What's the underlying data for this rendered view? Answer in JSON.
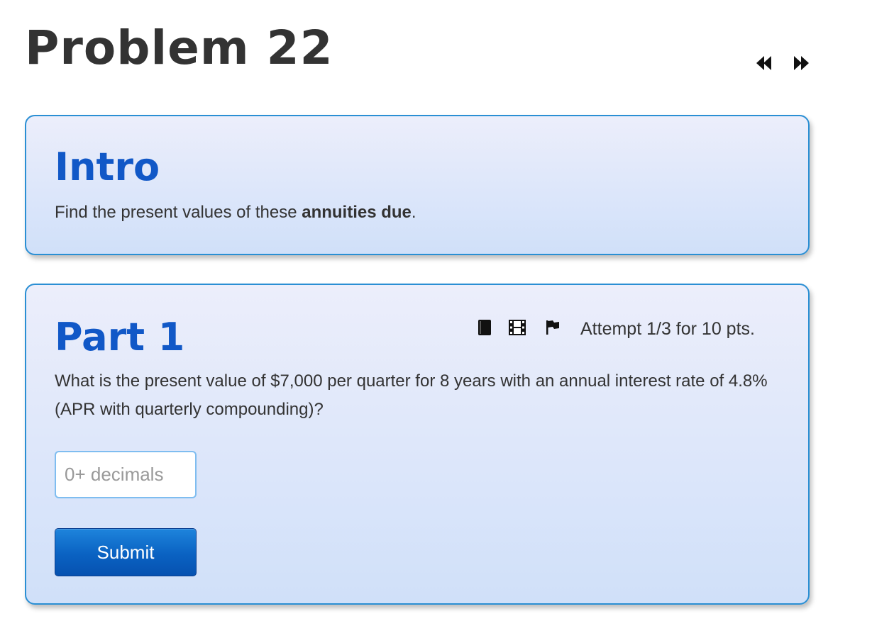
{
  "page": {
    "title": "Problem 22"
  },
  "nav": {
    "prev_icon": "rewind-icon",
    "next_icon": "fast-forward-icon"
  },
  "intro": {
    "heading": "Intro",
    "text_before": "Find the present values of these ",
    "text_bold": "annuities due",
    "text_after": "."
  },
  "part1": {
    "heading": "Part 1",
    "toolbar_icons": [
      "book-icon",
      "film-icon",
      "flag-icon"
    ],
    "attempt": "Attempt 1/3 for 10 pts.",
    "question": "What is the present value of $7,000 per quarter for 8 years with an annual interest rate of 4.8% (APR with quarterly compounding)?",
    "input": {
      "value": "",
      "placeholder": "0+ decimals"
    },
    "submit_label": "Submit"
  },
  "colors": {
    "heading_blue": "#1158c7",
    "card_border": "#2a8fd4",
    "button_blue": "#0a62c2",
    "text": "#333333"
  }
}
